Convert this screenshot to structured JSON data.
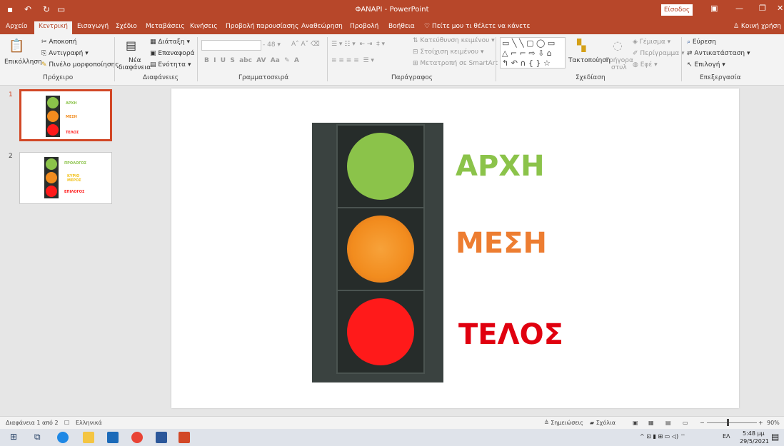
{
  "titlebar": {
    "title": "ΦΑΝΑΡΙ  -  PowerPoint",
    "signin": "Είσοδος",
    "accent": "#b7472a"
  },
  "tabs": [
    "Αρχείο",
    "Κεντρική",
    "Εισαγωγή",
    "Σχέδιο",
    "Μεταβάσεις",
    "Κινήσεις",
    "Προβολή παρουσίασης",
    "Αναθεώρηση",
    "Προβολή",
    "Βοήθεια"
  ],
  "tell_me": "Πείτε μου τι θέλετε να κάνετε",
  "share": "Κοινή χρήση",
  "ribbon": {
    "clipboard": {
      "paste": "Επικόλληση",
      "cut": "Αποκοπή",
      "copy": "Αντιγραφή",
      "format_painter": "Πινέλο μορφοποίησης",
      "group": "Πρόχειρο"
    },
    "slides": {
      "new_slide_1": "Νέα",
      "new_slide_2": "διαφάνεια",
      "layout": "Διάταξη",
      "reset": "Επαναφορά",
      "section": "Ενότητα",
      "group": "Διαφάνειες"
    },
    "font": {
      "size": "48",
      "group": "Γραμματοσειρά"
    },
    "paragraph": {
      "text_direction": "Κατεύθυνση κειμένου",
      "align_text": "Στοίχιση κειμένου",
      "smartart": "Μετατροπή σε SmartArt",
      "group": "Παράγραφος"
    },
    "drawing": {
      "arrange": "Τακτοποίηση",
      "quick_styles_1": "Γρήγορα",
      "quick_styles_2": "στυλ",
      "fill": "Γέμισμα",
      "outline": "Περίγραμμα",
      "effects": "Εφέ",
      "group": "Σχεδίαση"
    },
    "editing": {
      "find": "Εύρεση",
      "replace": "Αντικατάσταση",
      "select": "Επιλογή",
      "group": "Επεξεργασία"
    }
  },
  "thumbnails": [
    {
      "number": "1",
      "labels": [
        "ΑΡΧΗ",
        "ΜΕΣΗ",
        "ΤΕΛΟΣ"
      ]
    },
    {
      "number": "2",
      "labels": [
        "ΠΡΟΛΟΓΟΣ",
        "ΚΥΡΙΟ ΜΕΡΟΣ",
        "ΕΠΙΛΟΓΟΣ"
      ]
    }
  ],
  "slide": {
    "word1": "ΑΡΧΗ",
    "word2": "ΜΕΣΗ",
    "word3": "ΤΕΛΟΣ",
    "colors": {
      "green": "#8bc34a",
      "orange": "#f28c1e",
      "red": "#ff1a1a"
    }
  },
  "status": {
    "slide_info": "Διαφάνεια 1 από 2",
    "language": "Ελληνικά",
    "notes": "Σημειώσεις",
    "comments": "Σχόλια",
    "zoom": "90%"
  },
  "taskbar": {
    "language": "ΕΛ",
    "time": "5:48 μμ",
    "date": "29/5/2021"
  }
}
